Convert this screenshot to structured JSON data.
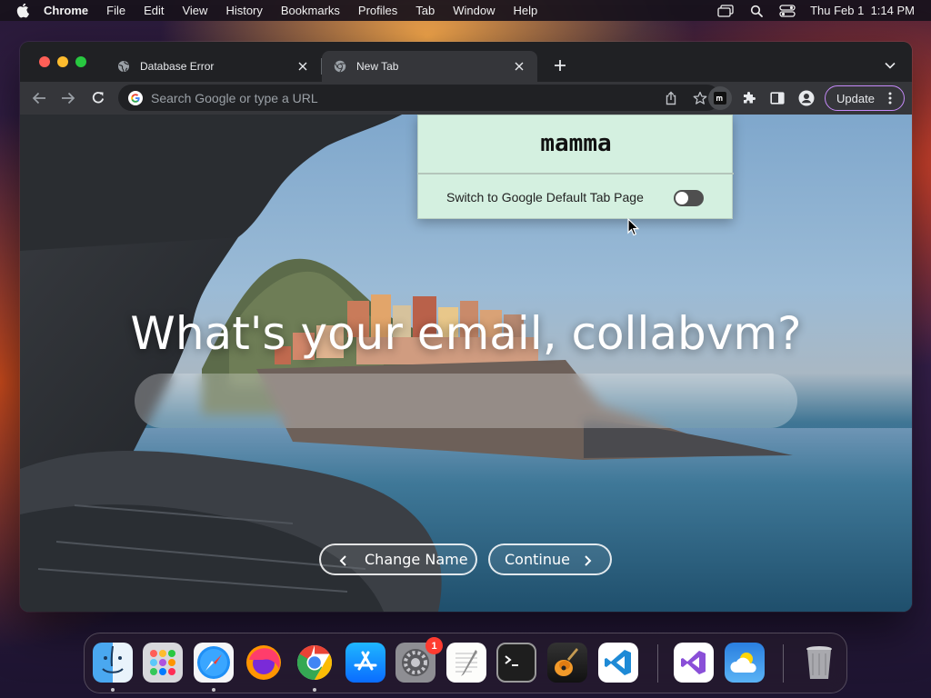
{
  "menubar": {
    "app_name": "Chrome",
    "menus": [
      "File",
      "Edit",
      "View",
      "History",
      "Bookmarks",
      "Profiles",
      "Tab",
      "Window",
      "Help"
    ],
    "clock": "Thu Feb 1  1:14 PM"
  },
  "tabs": [
    {
      "title": "Database Error",
      "favicon": "globe-icon",
      "active": false
    },
    {
      "title": "New Tab",
      "favicon": "chrome-icon",
      "active": true
    }
  ],
  "omnibox": {
    "placeholder": "Search Google or type a URL"
  },
  "toolbar": {
    "update_label": "Update"
  },
  "popup": {
    "logo_text": "mamma",
    "toggle_label": "Switch to Google Default Tab Page",
    "toggle_on": false
  },
  "page": {
    "headline": "What's your email, collabvm?",
    "email_value": "",
    "change_name_label": "Change Name",
    "continue_label": "Continue"
  },
  "dock": {
    "apps": [
      "Finder",
      "Launchpad",
      "Safari",
      "Firefox",
      "Chrome",
      "App Store",
      "System Settings",
      "TextEdit",
      "Terminal",
      "GarageBand",
      "Visual Studio Code",
      "Visual Studio",
      "Weather",
      "Trash"
    ],
    "system_settings_badge": "1"
  },
  "colors": {
    "chrome_bg": "#202124",
    "toolbar_bg": "#35363a",
    "popup_bg": "#d4f0e0",
    "update_border": "#c58af9",
    "badge_red": "#ff3b30"
  }
}
